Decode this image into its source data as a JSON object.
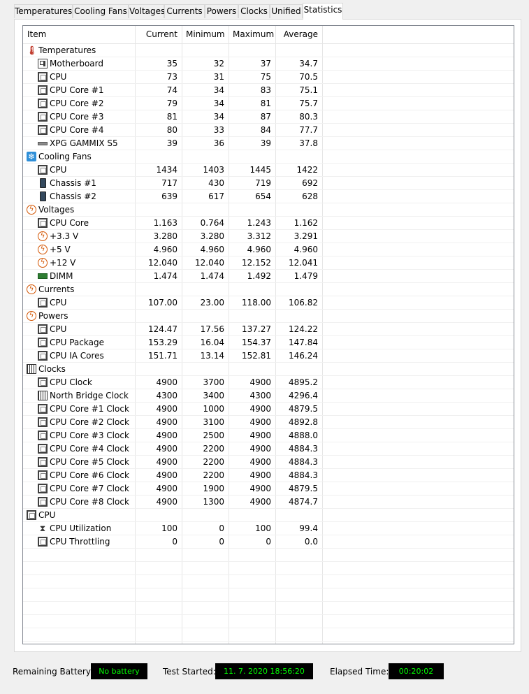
{
  "tabs": [
    "Temperatures",
    "Cooling Fans",
    "Voltages",
    "Currents",
    "Powers",
    "Clocks",
    "Unified",
    "Statistics"
  ],
  "active_tab": "Statistics",
  "columns": {
    "item": "Item",
    "current": "Current",
    "minimum": "Minimum",
    "maximum": "Maximum",
    "average": "Average"
  },
  "rows": [
    {
      "type": "category",
      "icon": "thermometer-icon",
      "name": "Temperatures"
    },
    {
      "type": "item",
      "icon": "motherboard-icon",
      "name": "Motherboard",
      "current": "35",
      "minimum": "32",
      "maximum": "37",
      "average": "34.7"
    },
    {
      "type": "item",
      "icon": "cpu-icon",
      "name": "CPU",
      "current": "73",
      "minimum": "31",
      "maximum": "75",
      "average": "70.5"
    },
    {
      "type": "item",
      "icon": "cpu-icon",
      "name": "CPU Core #1",
      "current": "74",
      "minimum": "34",
      "maximum": "83",
      "average": "75.1"
    },
    {
      "type": "item",
      "icon": "cpu-icon",
      "name": "CPU Core #2",
      "current": "79",
      "minimum": "34",
      "maximum": "81",
      "average": "75.7"
    },
    {
      "type": "item",
      "icon": "cpu-icon",
      "name": "CPU Core #3",
      "current": "81",
      "minimum": "34",
      "maximum": "87",
      "average": "80.3"
    },
    {
      "type": "item",
      "icon": "cpu-icon",
      "name": "CPU Core #4",
      "current": "80",
      "minimum": "33",
      "maximum": "84",
      "average": "77.7"
    },
    {
      "type": "item",
      "icon": "drive-icon",
      "name": "XPG GAMMIX S5",
      "current": "39",
      "minimum": "36",
      "maximum": "39",
      "average": "37.8"
    },
    {
      "type": "category",
      "icon": "fan-icon",
      "name": "Cooling Fans"
    },
    {
      "type": "item",
      "icon": "cpu-icon",
      "name": "CPU",
      "current": "1434",
      "minimum": "1403",
      "maximum": "1445",
      "average": "1422"
    },
    {
      "type": "item",
      "icon": "chassis-icon",
      "name": "Chassis #1",
      "current": "717",
      "minimum": "430",
      "maximum": "719",
      "average": "692"
    },
    {
      "type": "item",
      "icon": "chassis-icon",
      "name": "Chassis #2",
      "current": "639",
      "minimum": "617",
      "maximum": "654",
      "average": "628"
    },
    {
      "type": "category",
      "icon": "voltage-icon",
      "name": "Voltages"
    },
    {
      "type": "item",
      "icon": "cpu-icon",
      "name": "CPU Core",
      "current": "1.163",
      "minimum": "0.764",
      "maximum": "1.243",
      "average": "1.162"
    },
    {
      "type": "item",
      "icon": "voltage-icon",
      "name": "+3.3 V",
      "current": "3.280",
      "minimum": "3.280",
      "maximum": "3.312",
      "average": "3.291"
    },
    {
      "type": "item",
      "icon": "voltage-icon",
      "name": "+5 V",
      "current": "4.960",
      "minimum": "4.960",
      "maximum": "4.960",
      "average": "4.960"
    },
    {
      "type": "item",
      "icon": "voltage-icon",
      "name": "+12 V",
      "current": "12.040",
      "minimum": "12.040",
      "maximum": "12.152",
      "average": "12.041"
    },
    {
      "type": "item",
      "icon": "dimm-icon",
      "name": "DIMM",
      "current": "1.474",
      "minimum": "1.474",
      "maximum": "1.492",
      "average": "1.479"
    },
    {
      "type": "category",
      "icon": "current-icon",
      "name": "Currents"
    },
    {
      "type": "item",
      "icon": "cpu-icon",
      "name": "CPU",
      "current": "107.00",
      "minimum": "23.00",
      "maximum": "118.00",
      "average": "106.82"
    },
    {
      "type": "category",
      "icon": "power-icon",
      "name": "Powers"
    },
    {
      "type": "item",
      "icon": "cpu-icon",
      "name": "CPU",
      "current": "124.47",
      "minimum": "17.56",
      "maximum": "137.27",
      "average": "124.22"
    },
    {
      "type": "item",
      "icon": "cpu-icon",
      "name": "CPU Package",
      "current": "153.29",
      "minimum": "16.04",
      "maximum": "154.37",
      "average": "147.84"
    },
    {
      "type": "item",
      "icon": "cpu-icon",
      "name": "CPU IA Cores",
      "current": "151.71",
      "minimum": "13.14",
      "maximum": "152.81",
      "average": "146.24"
    },
    {
      "type": "category",
      "icon": "clock-category-icon",
      "name": "Clocks"
    },
    {
      "type": "item",
      "icon": "cpu-icon",
      "name": "CPU Clock",
      "current": "4900",
      "minimum": "3700",
      "maximum": "4900",
      "average": "4895.2"
    },
    {
      "type": "item",
      "icon": "chipset-icon",
      "name": "North Bridge Clock",
      "current": "4300",
      "minimum": "3400",
      "maximum": "4300",
      "average": "4296.4"
    },
    {
      "type": "item",
      "icon": "cpu-icon",
      "name": "CPU Core #1 Clock",
      "current": "4900",
      "minimum": "1000",
      "maximum": "4900",
      "average": "4879.5"
    },
    {
      "type": "item",
      "icon": "cpu-icon",
      "name": "CPU Core #2 Clock",
      "current": "4900",
      "minimum": "3100",
      "maximum": "4900",
      "average": "4892.8"
    },
    {
      "type": "item",
      "icon": "cpu-icon",
      "name": "CPU Core #3 Clock",
      "current": "4900",
      "minimum": "2500",
      "maximum": "4900",
      "average": "4888.0"
    },
    {
      "type": "item",
      "icon": "cpu-icon",
      "name": "CPU Core #4 Clock",
      "current": "4900",
      "minimum": "2200",
      "maximum": "4900",
      "average": "4884.3"
    },
    {
      "type": "item",
      "icon": "cpu-icon",
      "name": "CPU Core #5 Clock",
      "current": "4900",
      "minimum": "2200",
      "maximum": "4900",
      "average": "4884.3"
    },
    {
      "type": "item",
      "icon": "cpu-icon",
      "name": "CPU Core #6 Clock",
      "current": "4900",
      "minimum": "2200",
      "maximum": "4900",
      "average": "4884.3"
    },
    {
      "type": "item",
      "icon": "cpu-icon",
      "name": "CPU Core #7 Clock",
      "current": "4900",
      "minimum": "1900",
      "maximum": "4900",
      "average": "4879.5"
    },
    {
      "type": "item",
      "icon": "cpu-icon",
      "name": "CPU Core #8 Clock",
      "current": "4900",
      "minimum": "1300",
      "maximum": "4900",
      "average": "4874.7"
    },
    {
      "type": "category",
      "icon": "cpu-icon",
      "name": "CPU"
    },
    {
      "type": "item",
      "icon": "hourglass-icon",
      "name": "CPU Utilization",
      "current": "100",
      "minimum": "0",
      "maximum": "100",
      "average": "99.4"
    },
    {
      "type": "item",
      "icon": "cpu-icon",
      "name": "CPU Throttling",
      "current": "0",
      "minimum": "0",
      "maximum": "0",
      "average": "0.0"
    }
  ],
  "status": {
    "battery_label": "Remaining Battery:",
    "battery_value": "No battery",
    "test_started_label": "Test Started:",
    "test_started_value": "11. 7. 2020 18:56:20",
    "elapsed_label": "Elapsed Time:",
    "elapsed_value": "00:20:02"
  },
  "colors": {
    "status_bg": "#000000",
    "status_text": "#00ff00",
    "list_border": "#828790"
  }
}
